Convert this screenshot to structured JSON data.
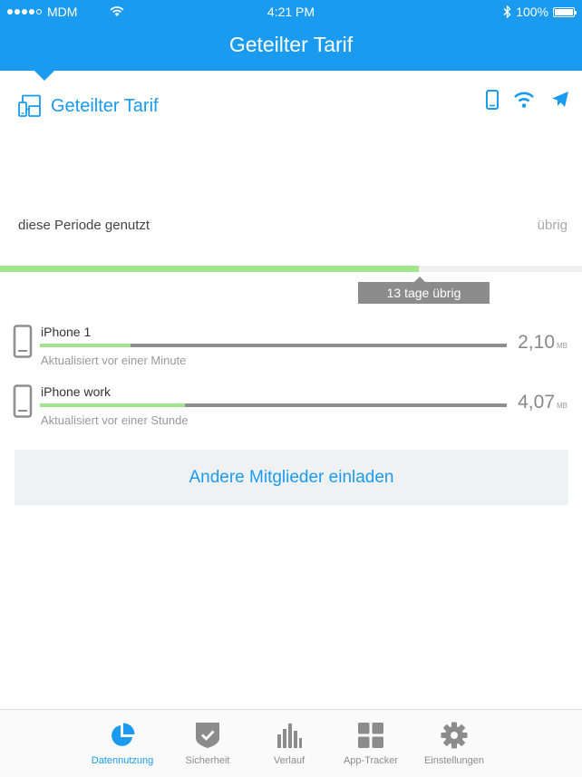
{
  "status_bar": {
    "carrier": "MDM",
    "time": "4:21 PM",
    "battery": "100%"
  },
  "nav": {
    "title": "Geteilter Tarif"
  },
  "plan": {
    "title": "Geteilter Tarif",
    "period_label": "diese Periode genutzt",
    "remaining_label": "übrig",
    "period_progress": 0.72,
    "days_left": "13 tage übrig",
    "header_icons": [
      "smartphone-icon",
      "wifi-icon",
      "airplane-icon"
    ]
  },
  "devices": [
    {
      "name": "iPhone 1",
      "updated": "Aktualisiert vor einer Minute",
      "usage_value": "2,10",
      "usage_unit": "MB",
      "usage_fraction": 0.195
    },
    {
      "name": "iPhone work",
      "updated": "Aktualisiert vor einer Stunde",
      "usage_value": "4,07",
      "usage_unit": "MB",
      "usage_fraction": 0.31
    }
  ],
  "invite_button": "Andere Mitglieder einladen",
  "tabs": [
    {
      "label": "Datennutzung",
      "icon": "pie-chart-icon",
      "active": true
    },
    {
      "label": "Sicherheit",
      "icon": "shield-icon",
      "active": false
    },
    {
      "label": "Verlauf",
      "icon": "bar-chart-icon",
      "active": false
    },
    {
      "label": "App-Tracker",
      "icon": "grid-icon",
      "active": false
    },
    {
      "label": "Einstellungen",
      "icon": "gear-icon",
      "active": false
    }
  ],
  "colors": {
    "primary": "#1a9bf0",
    "progress_fill": "#a3e48c",
    "bar_gray": "#8e8e8e"
  }
}
